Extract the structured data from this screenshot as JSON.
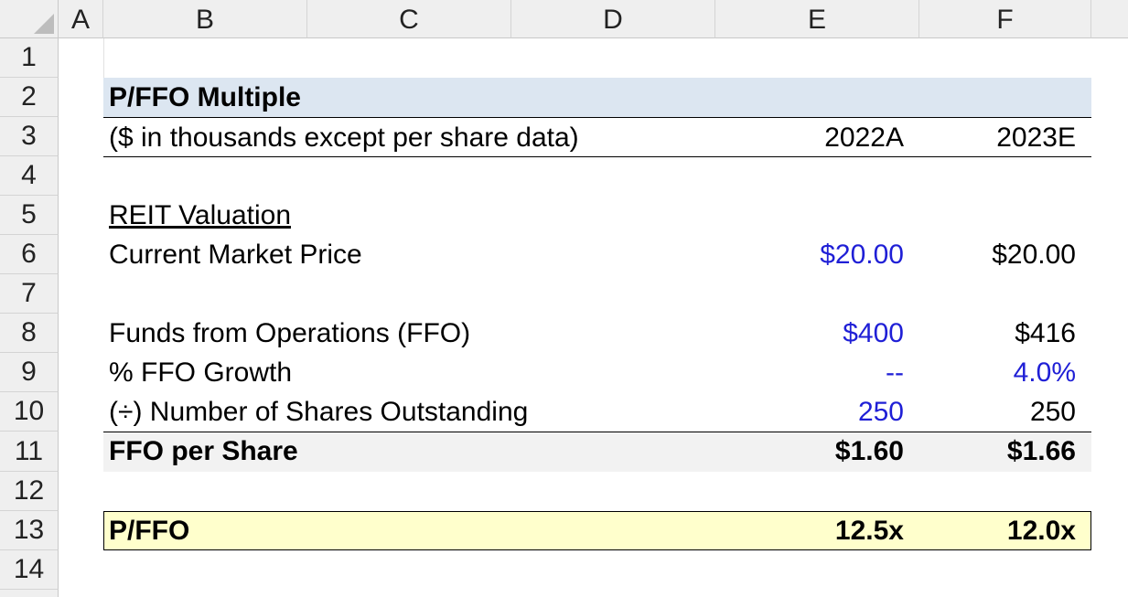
{
  "columns": [
    "A",
    "B",
    "C",
    "D",
    "E",
    "F"
  ],
  "rows": [
    "1",
    "2",
    "3",
    "4",
    "5",
    "6",
    "7",
    "8",
    "9",
    "10",
    "11",
    "12",
    "13",
    "14"
  ],
  "sheet": {
    "title": "P/FFO Multiple",
    "subtitle": "($ in thousands except per share data)",
    "year_e": "2022A",
    "year_f": "2023E",
    "section": "REIT Valuation",
    "price_label": "Current Market Price",
    "price_e": "$20.00",
    "price_f": "$20.00",
    "ffo_label": "Funds from Operations (FFO)",
    "ffo_e": "$400",
    "ffo_f": "$416",
    "growth_label": "% FFO Growth",
    "growth_e": "--",
    "growth_f": "4.0%",
    "shares_label": "(÷) Number of Shares Outstanding",
    "shares_e": "250",
    "shares_f": "250",
    "ffops_label": "FFO per Share",
    "ffops_e": "$1.60",
    "ffops_f": "$1.66",
    "pffo_label": "P/FFO",
    "pffo_e": "12.5x",
    "pffo_f": "12.0x"
  },
  "colors": {
    "title_band": "#dce6f1",
    "ffops_band": "#f2f2f2",
    "pffo_band": "#ffffcc",
    "input_blue": "#1f1fd6"
  }
}
